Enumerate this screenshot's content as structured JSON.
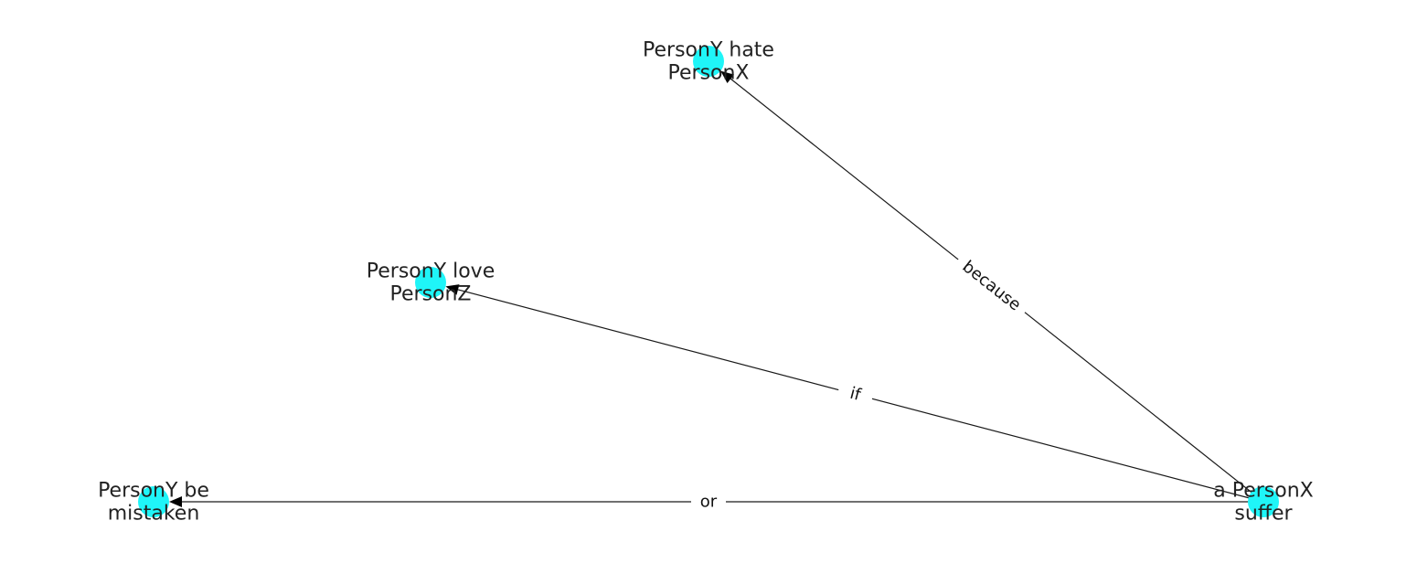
{
  "graph": {
    "node_color": "#1ff5f8",
    "edge_color": "#1a1a1a",
    "nodes": [
      {
        "id": "hate",
        "lines": [
          "PersonY hate",
          "PersonX"
        ]
      },
      {
        "id": "love",
        "lines": [
          "PersonY love",
          "PersonZ"
        ]
      },
      {
        "id": "mistaken",
        "lines": [
          "PersonY be",
          "mistaken"
        ]
      },
      {
        "id": "suffer",
        "lines": [
          "a PersonX",
          "suffer"
        ]
      }
    ],
    "edges": [
      {
        "from": "suffer",
        "to": "hate",
        "label": "because"
      },
      {
        "from": "suffer",
        "to": "love",
        "label": "if"
      },
      {
        "from": "suffer",
        "to": "mistaken",
        "label": "or"
      }
    ]
  }
}
